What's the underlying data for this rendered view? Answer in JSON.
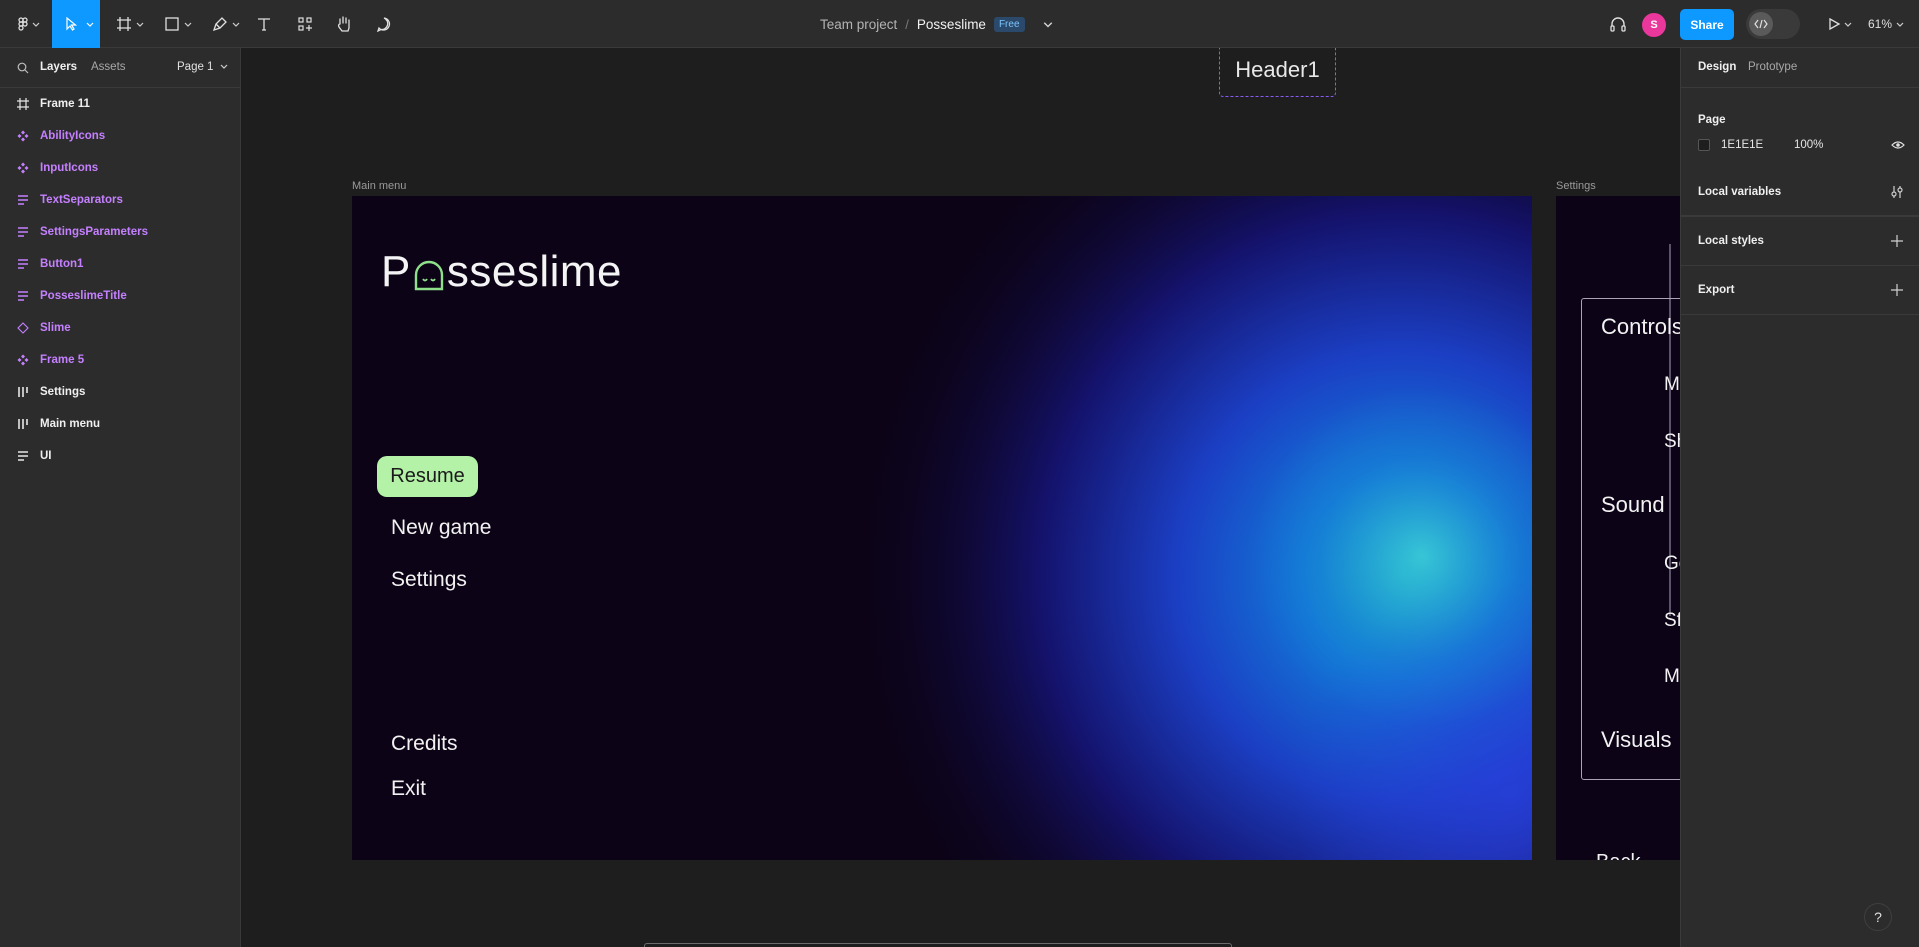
{
  "toolbar": {
    "breadcrumb": "Team project",
    "separator": "/",
    "file_name": "Posseslime",
    "plan_badge": "Free",
    "avatar_initial": "S",
    "share_label": "Share",
    "zoom": "61%",
    "accent": "#0d99ff"
  },
  "left_panel": {
    "tabs": {
      "layers": "Layers",
      "assets": "Assets",
      "page": "Page 1"
    },
    "layers": [
      {
        "name": "Frame 11",
        "icon": "frame-icon",
        "color": "white"
      },
      {
        "name": "AbilityIcons",
        "icon": "component-icon",
        "color": "purple"
      },
      {
        "name": "InputIcons",
        "icon": "component-icon",
        "color": "purple"
      },
      {
        "name": "TextSeparators",
        "icon": "auto-layout-vertical-icon",
        "color": "purple"
      },
      {
        "name": "SettingsParameters",
        "icon": "auto-layout-vertical-icon",
        "color": "purple"
      },
      {
        "name": "Button1",
        "icon": "auto-layout-vertical-icon",
        "color": "purple"
      },
      {
        "name": "PosseslimeTitle",
        "icon": "auto-layout-vertical-icon",
        "color": "purple"
      },
      {
        "name": "Slime",
        "icon": "instance-icon",
        "color": "purple"
      },
      {
        "name": "Frame 5",
        "icon": "component-icon",
        "color": "purple"
      },
      {
        "name": "Settings",
        "icon": "auto-layout-horizontal-icon",
        "color": "white"
      },
      {
        "name": "Main menu",
        "icon": "auto-layout-horizontal-icon",
        "color": "white"
      },
      {
        "name": "UI",
        "icon": "auto-layout-vertical-icon",
        "color": "white"
      }
    ]
  },
  "canvas": {
    "header_label": "Header1",
    "main_menu_label": "Main menu",
    "settings_label": "Settings",
    "main_menu": {
      "logo_left": "P",
      "logo_right": "sseslime",
      "resume": "Resume",
      "new_game": "New game",
      "settings": "Settings",
      "credits": "Credits",
      "exit": "Exit",
      "resume_color": "#b4f2a8"
    },
    "settings": {
      "controls": "Controls",
      "sound": "Sound",
      "visuals": "Visuals",
      "back": "Back",
      "controls_sub": [
        "M",
        "Sh"
      ],
      "sound_sub": [
        "Ge",
        "Sf",
        "M"
      ]
    }
  },
  "right_panel": {
    "tabs": {
      "design": "Design",
      "prototype": "Prototype"
    },
    "page_heading": "Page",
    "page_color": "1E1E1E",
    "page_opacity": "100%",
    "local_variables": "Local variables",
    "local_styles": "Local styles",
    "export": "Export"
  },
  "help_label": "?"
}
